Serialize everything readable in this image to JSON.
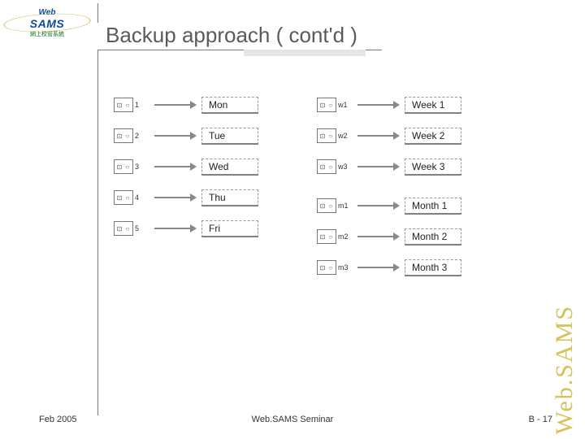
{
  "logo": {
    "web": "Web",
    "sams": "SAMS",
    "sub": "網上校管系統"
  },
  "title": "Backup approach ( cont'd )",
  "daily_tapes": [
    {
      "sub": "1",
      "label": "Mon"
    },
    {
      "sub": "2",
      "label": "Tue"
    },
    {
      "sub": "3",
      "label": "Wed"
    },
    {
      "sub": "4",
      "label": "Thu"
    },
    {
      "sub": "5",
      "label": "Fri"
    }
  ],
  "weekly_tapes": [
    {
      "sub": "w1",
      "label": "Week 1"
    },
    {
      "sub": "w2",
      "label": "Week 2"
    },
    {
      "sub": "w3",
      "label": "Week 3"
    }
  ],
  "monthly_tapes": [
    {
      "sub": "m1",
      "label": "Month 1"
    },
    {
      "sub": "m2",
      "label": "Month 2"
    },
    {
      "sub": "m3",
      "label": "Month 3"
    }
  ],
  "footer": {
    "left": "Feb 2005",
    "center": "Web.SAMS Seminar",
    "right": "B - 17"
  },
  "side_text": "Web.SAMS"
}
